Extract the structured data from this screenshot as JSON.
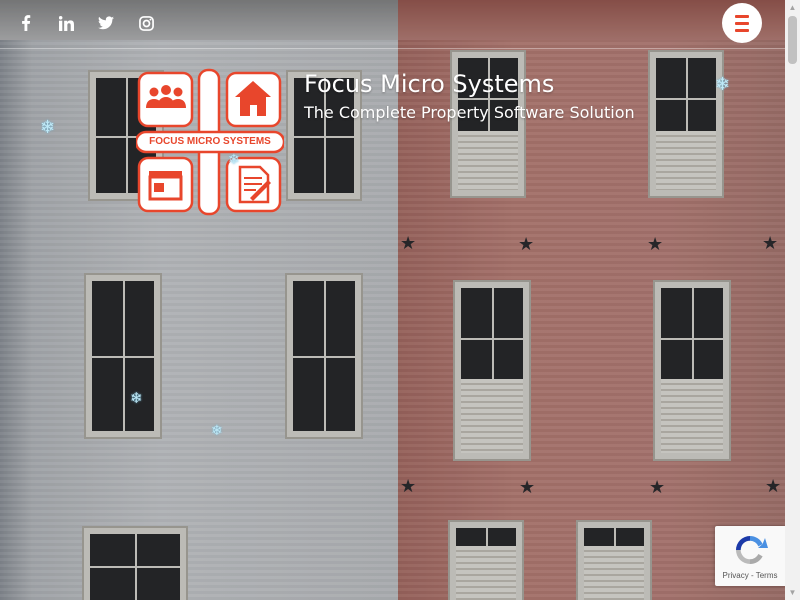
{
  "header": {
    "social": [
      {
        "name": "facebook",
        "glyph": "f"
      },
      {
        "name": "linkedin",
        "glyph": "in"
      },
      {
        "name": "twitter",
        "glyph": "twitter-bird"
      },
      {
        "name": "instagram",
        "glyph": "camera"
      }
    ],
    "menu_icon": "hamburger-icon"
  },
  "brand": {
    "title": "Focus Micro Systems",
    "tagline": "The Complete Property Software Solution",
    "logo_text": "FOCUS MICRO SYSTEMS",
    "accent_color": "#e8462c"
  },
  "recaptcha": {
    "privacy": "Privacy",
    "separator": "-",
    "terms": "Terms"
  },
  "decor": {
    "snowflake_glyph": "❄",
    "star_glyph": "★"
  }
}
